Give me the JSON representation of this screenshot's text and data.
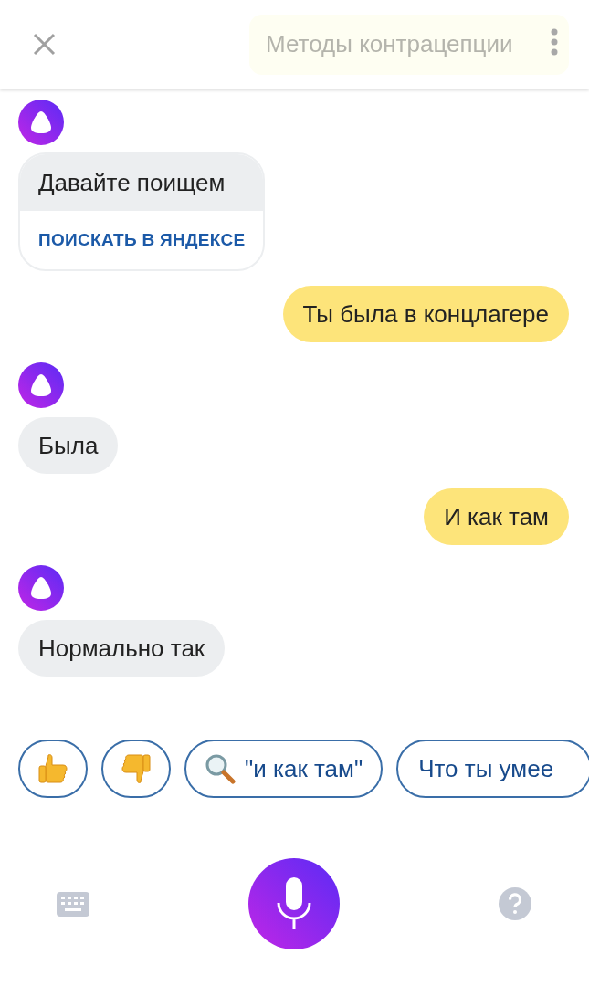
{
  "header": {
    "title": "Методы контрацепции"
  },
  "messages": [
    {
      "kind": "alice",
      "text": "Давайте поищем",
      "action": "ПОИСКАТЬ В ЯНДЕКСЕ"
    },
    {
      "kind": "user",
      "text": "Ты была в концлагере"
    },
    {
      "kind": "alice",
      "text": "Была"
    },
    {
      "kind": "user",
      "text": "И как там"
    },
    {
      "kind": "alice",
      "text": "Нормально так"
    }
  ],
  "suggestions": [
    {
      "kind": "like"
    },
    {
      "kind": "dislike"
    },
    {
      "kind": "search",
      "text": "\"и как там\""
    },
    {
      "kind": "text",
      "text": "Что ты умее"
    }
  ]
}
